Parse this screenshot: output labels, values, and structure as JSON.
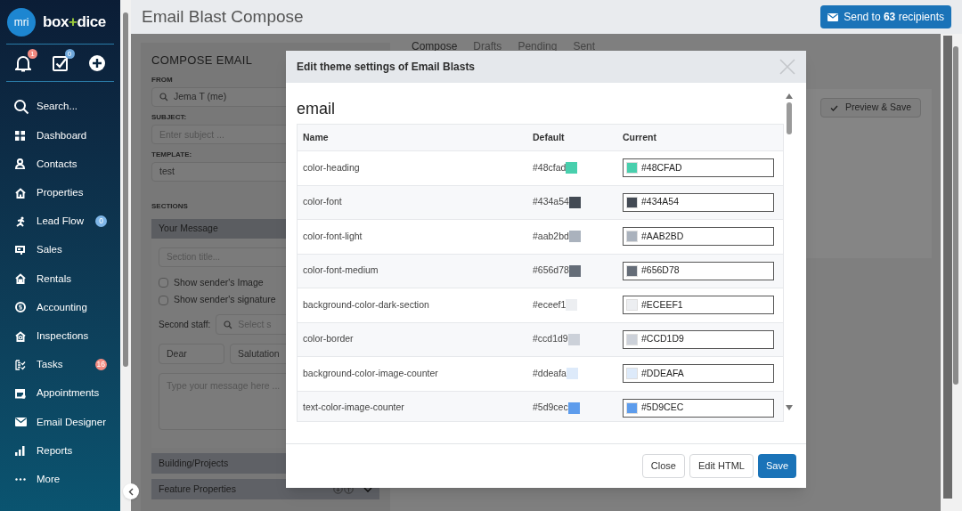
{
  "sidebar": {
    "logo_mark": "mri",
    "brand": [
      "box",
      "+",
      "dice"
    ],
    "quick_actions": [
      {
        "kind": "bell",
        "badge": "1",
        "color": "#f28b82"
      },
      {
        "kind": "tasks",
        "badge": "0",
        "color": "#6fa8dc"
      },
      {
        "kind": "add"
      }
    ],
    "items": [
      {
        "label": "Search..."
      },
      {
        "label": "Dashboard"
      },
      {
        "label": "Contacts"
      },
      {
        "label": "Properties"
      },
      {
        "label": "Lead Flow",
        "badge": "0",
        "color": "#7fb6e8"
      },
      {
        "label": "Sales"
      },
      {
        "label": "Rentals"
      },
      {
        "label": "Accounting"
      },
      {
        "label": "Inspections"
      },
      {
        "label": "Tasks",
        "badge": "16",
        "color": "#f28b82"
      },
      {
        "label": "Appointments"
      },
      {
        "label": "Email Designer"
      },
      {
        "label": "Reports"
      },
      {
        "label": "More"
      }
    ]
  },
  "header": {
    "title": "Email Blast Compose",
    "send_button": "Send to **63** recipients"
  },
  "compose": {
    "heading": "COMPOSE EMAIL",
    "from_label": "FROM",
    "from_value": "Jema T (me)",
    "subject_label": "SUBJECT:",
    "subject_placeholder": "Enter subject ...",
    "template_label": "TEMPLATE:",
    "template_value": "test",
    "sections_label": "SECTIONS",
    "message_section": {
      "title": "Your Message",
      "title_placeholder": "Section title...",
      "options": [
        {
          "label": "Show sender's Image",
          "checked": false
        },
        {
          "label": "Show sender's signature",
          "checked": false
        }
      ],
      "second_staff_label": "Second staff:",
      "second_staff_placeholder": "Select s",
      "greeting": "Dear",
      "salutation": "Salutation",
      "message_placeholder": "Type your message here ..."
    },
    "other_sections": [
      "Building/Projects",
      "Feature Properties"
    ]
  },
  "tabs": [
    {
      "label": "Compose",
      "selected": true
    },
    {
      "label": "Drafts",
      "selected": false
    },
    {
      "label": "Pending",
      "selected": false
    },
    {
      "label": "Sent",
      "selected": false
    }
  ],
  "preview_button": "Preview & Save",
  "modal": {
    "title": "Edit theme settings of Email Blasts",
    "section": "email",
    "columns": [
      "Name",
      "Default",
      "Current"
    ],
    "rows": [
      {
        "name": "color-heading",
        "default": "#48cfad",
        "current": "#48CFAD",
        "color": "#48cfad"
      },
      {
        "name": "color-font",
        "default": "#434a54",
        "current": "#434A54",
        "color": "#434a54"
      },
      {
        "name": "color-font-light",
        "default": "#aab2bd",
        "current": "#AAB2BD",
        "color": "#aab2bd"
      },
      {
        "name": "color-font-medium",
        "default": "#656d78",
        "current": "#656D78",
        "color": "#656d78"
      },
      {
        "name": "background-color-dark-section",
        "default": "#eceef1",
        "current": "#ECEEF1",
        "color": "#eceef1"
      },
      {
        "name": "color-border",
        "default": "#ccd1d9",
        "current": "#CCD1D9",
        "color": "#ccd1d9"
      },
      {
        "name": "background-color-image-counter",
        "default": "#ddeafa",
        "current": "#DDEAFA",
        "color": "#ddeafa"
      },
      {
        "name": "text-color-image-counter",
        "default": "#5d9cec",
        "current": "#5D9CEC",
        "color": "#5d9cec"
      }
    ],
    "buttons": [
      "Close",
      "Edit HTML",
      "Save"
    ]
  }
}
